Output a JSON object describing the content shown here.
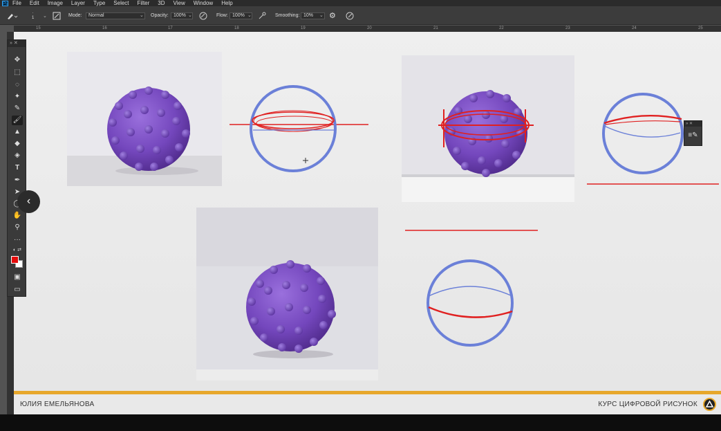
{
  "menubar": {
    "app_icon": "Ps",
    "items": [
      "File",
      "Edit",
      "Image",
      "Layer",
      "Type",
      "Select",
      "Filter",
      "3D",
      "View",
      "Window",
      "Help"
    ]
  },
  "options": {
    "brush_size": "1",
    "mode_label": "Mode:",
    "mode_value": "Normal",
    "opacity_label": "Opacity:",
    "opacity_value": "100%",
    "flow_label": "Flow:",
    "flow_value": "100%",
    "smoothing_label": "Smoothing:",
    "smoothing_value": "10%"
  },
  "ruler": {
    "ticks": [
      "15",
      "16",
      "17",
      "18",
      "19",
      "20",
      "21",
      "22",
      "23",
      "24",
      "25"
    ]
  },
  "toolbar": {
    "tools": [
      "move-icon",
      "marquee-icon",
      "lasso-icon",
      "magic-wand-icon",
      "eyedropper-icon",
      "brush-icon",
      "stamp-icon",
      "eraser-icon",
      "paint-bucket-icon",
      "type-icon",
      "pen-icon",
      "path-select-icon",
      "ellipse-icon",
      "hand-icon",
      "zoom-icon",
      "more-icon"
    ],
    "foreground_color": "#e30b0b",
    "background_color": "#ffffff"
  },
  "footer": {
    "author": "ЮЛИЯ ЕМЕЛЬЯНОВА",
    "course": "КУРС ЦИФРОВОЙ РИСУНОК",
    "accent_color": "#e7a72b"
  },
  "colors": {
    "sphere_stroke": "#6b80d8",
    "sketch_red": "#e02020",
    "ball_purple": "#7a4cc0"
  }
}
